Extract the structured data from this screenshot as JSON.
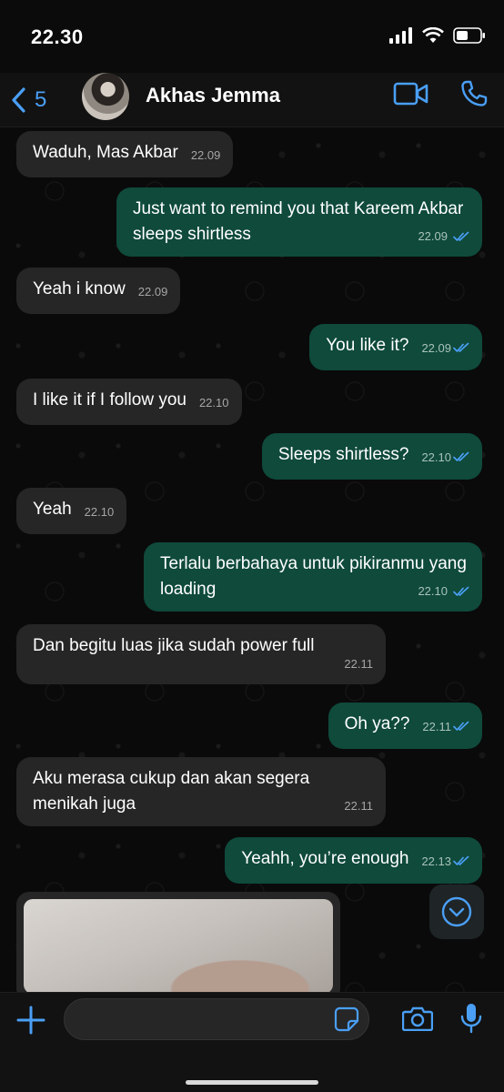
{
  "status": {
    "time": "22.30"
  },
  "header": {
    "back_count": "5",
    "contact_name": "Akhas Jemma"
  },
  "messages": [
    {
      "direction": "in",
      "text": "Waduh, Mas Akbar",
      "time": "22.09"
    },
    {
      "direction": "out",
      "text": "Just want to remind you that Kareem Akbar sleeps shirtless",
      "time": "22.09"
    },
    {
      "direction": "in",
      "text": "Yeah i know",
      "time": "22.09"
    },
    {
      "direction": "out",
      "text": "You like it?",
      "time": "22.09"
    },
    {
      "direction": "in",
      "text": "I like it if I follow you",
      "time": "22.10"
    },
    {
      "direction": "out",
      "text": "Sleeps shirtless?",
      "time": "22.10"
    },
    {
      "direction": "in",
      "text": "Yeah",
      "time": "22.10"
    },
    {
      "direction": "out",
      "text": "Terlalu berbahaya untuk pikiranmu yang loading",
      "time": "22.10"
    },
    {
      "direction": "in",
      "text": "Dan begitu luas jika sudah power full",
      "time": "22.11"
    },
    {
      "direction": "out",
      "text": "Oh ya??",
      "time": "22.11"
    },
    {
      "direction": "in",
      "text": "Aku merasa cukup dan akan segera menikah juga",
      "time": "22.11"
    },
    {
      "direction": "out",
      "text": "Yeahh, you’re enough",
      "time": "22.13"
    }
  ],
  "colors": {
    "accent": "#4a9ff5",
    "incoming_bubble": "#262626",
    "outgoing_bubble": "#0f4a3b",
    "read_ticks": "#4a9ff5"
  },
  "icons": {
    "back": "chevron-left-icon",
    "video_call": "video-camera-icon",
    "voice_call": "phone-icon",
    "scroll_down": "chevron-down-circle-icon",
    "attach": "plus-icon",
    "sticker": "sticker-icon",
    "camera": "camera-icon",
    "microphone": "microphone-icon",
    "read_receipt": "double-check-icon"
  }
}
